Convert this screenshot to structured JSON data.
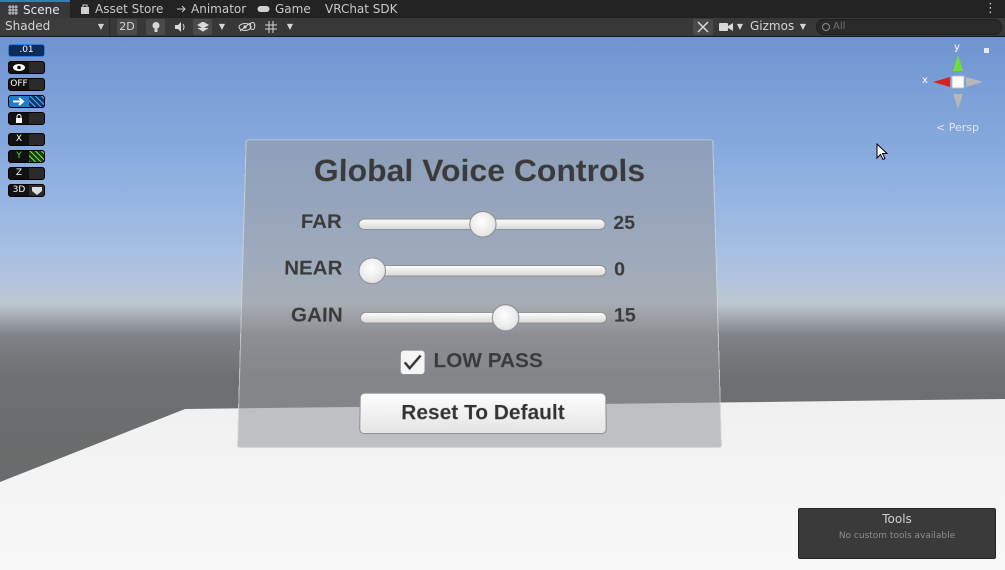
{
  "tabs": [
    {
      "label": "Scene",
      "icon": "scene-icon",
      "active": true
    },
    {
      "label": "Asset Store",
      "icon": "asset-store-icon"
    },
    {
      "label": "Animator",
      "icon": "animator-icon"
    },
    {
      "label": "Game",
      "icon": "game-icon"
    },
    {
      "label": "VRChat SDK"
    }
  ],
  "toolbar": {
    "draw_mode": "Shaded",
    "mode_2d": "2D",
    "hidden_count": "0",
    "gizmos": "Gizmos",
    "search_placeholder": "All"
  },
  "overlay": {
    "snap_value": ".01",
    "toggle_off": "OFF",
    "axis_x": "X",
    "axis_y": "Y",
    "axis_z": "Z",
    "mode_3d": "3D"
  },
  "gizmo": {
    "x_label": "x",
    "y_label": "y",
    "persp_label": "Persp"
  },
  "panel": {
    "title": "Global Voice Controls",
    "sliders": [
      {
        "label": "FAR",
        "value": "25",
        "fill": 0.5
      },
      {
        "label": "NEAR",
        "value": "0",
        "fill": 0.0
      },
      {
        "label": "GAIN",
        "value": "15",
        "fill": 0.6
      }
    ],
    "low_pass_label": "LOW PASS",
    "low_pass_checked": true,
    "reset_label": "Reset To Default"
  },
  "tools_panel": {
    "title": "Tools",
    "subtitle": "No custom tools available"
  },
  "colors": {
    "tab_accent": "#3a79bb",
    "x_axis": "#d42222",
    "y_axis": "#6ce03a",
    "selected_blue": "#2f7be0"
  }
}
